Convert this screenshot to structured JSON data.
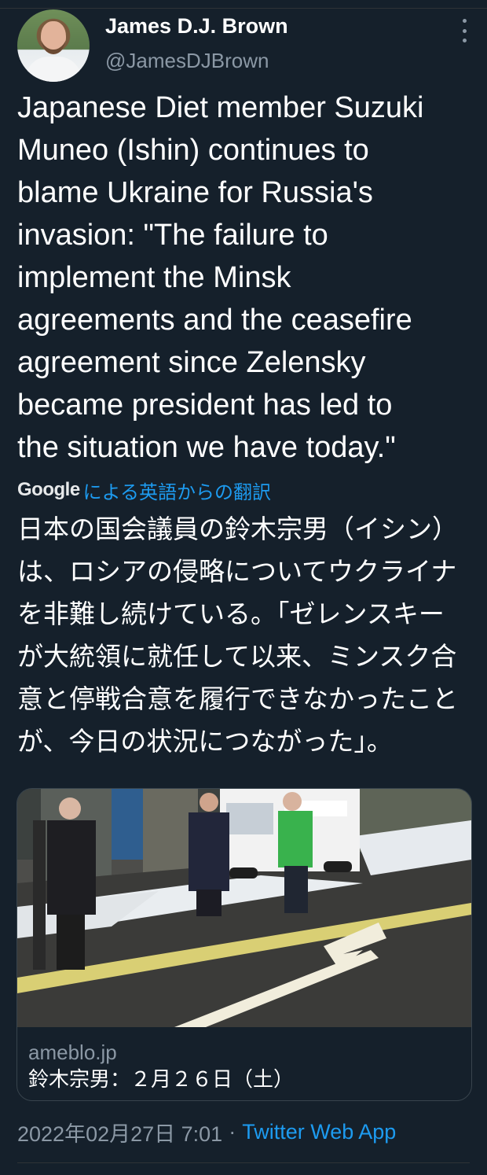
{
  "author": {
    "display_name": "James D.J. Brown",
    "handle": "@JamesDJBrown"
  },
  "tweet": {
    "text": "Japanese Diet member Suzuki\nMuneo (Ishin) continues to\nblame Ukraine for Russia's\ninvasion: \"The failure to\nimplement the Minsk\nagreements and the ceasefire\nagreement since Zelensky\nbecame president has led to\nthe situation we have today.\""
  },
  "translation": {
    "provider": "Google",
    "link_label": "による英語からの翻訳",
    "text": "日本の国会議員の鈴木宗男（イシン）\nは、ロシアの侵略についてウクライナ\nを非難し続けている。「ゼレンスキー\nが大統領に就任して以来、ミンスク合\n意と停戦合意を履行できなかったこと\nが、今日の状況につながった」。"
  },
  "card": {
    "domain": "ameblo.jp",
    "title": "鈴木宗男：２月２６日（土）"
  },
  "meta": {
    "timestamp": "2022年02月27日 7:01",
    "separator": "·",
    "source": "Twitter Web App"
  },
  "colors": {
    "background": "#15202b",
    "link": "#1d9bf0",
    "secondary_text": "#8b98a5"
  },
  "icons": {
    "more": "more-vertical-icon"
  }
}
